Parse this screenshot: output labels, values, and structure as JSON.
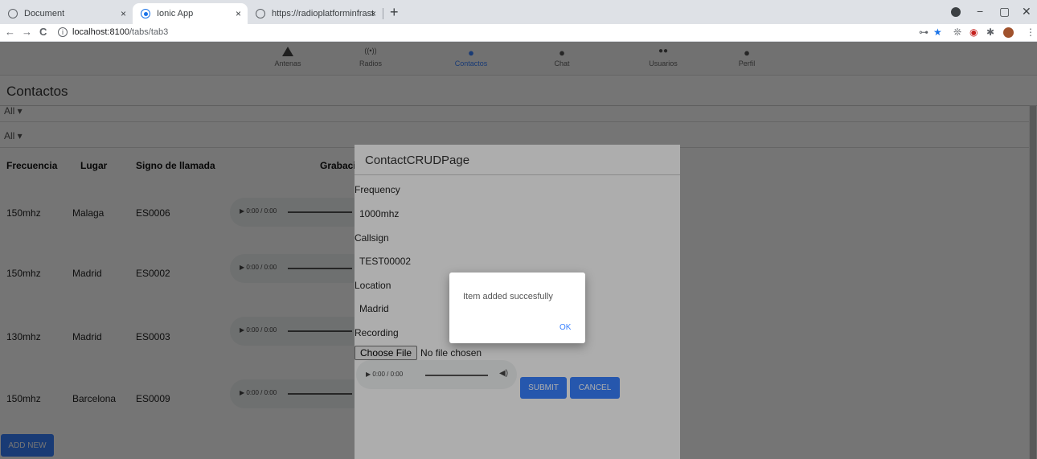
{
  "browser": {
    "tabs": [
      {
        "label": "Document",
        "active": false
      },
      {
        "label": "Ionic App",
        "active": true
      },
      {
        "label": "https://radioplatforminfrastructu",
        "active": false
      }
    ],
    "close_glyph": "×",
    "new_tab_glyph": "+",
    "window_controls": {
      "minimize": "−",
      "maximize": "▢",
      "close": "✕"
    },
    "nav": {
      "back": "←",
      "forward": "→",
      "reload": "C"
    },
    "info_glyph": "i",
    "url_host": "localhost:8100",
    "url_path": "/tabs/tab3",
    "extensions": {
      "key": "⊶",
      "star": "★",
      "bug": "❊",
      "shield": "◉",
      "puzzle": "✱",
      "menu": "⋮"
    }
  },
  "app": {
    "nav_tabs": [
      {
        "label": "Antenas",
        "icon": "antenna-icon",
        "glyph": "",
        "active": false
      },
      {
        "label": "Radios",
        "icon": "radio-signal-icon",
        "glyph": "((•))",
        "active": false
      },
      {
        "label": "Contactos",
        "icon": "person-icon",
        "glyph": "●",
        "active": true
      },
      {
        "label": "Chat",
        "icon": "chat-icon",
        "glyph": "●",
        "active": false
      },
      {
        "label": "Usuarios",
        "icon": "people-icon",
        "glyph": "●●",
        "active": false
      },
      {
        "label": "Perfil",
        "icon": "profile-icon",
        "glyph": "●",
        "active": false
      }
    ],
    "page_title": "Contactos",
    "filters": [
      "All ▾",
      "All ▾"
    ],
    "table": {
      "headers": [
        "Frecuencia",
        "Lugar",
        "Signo de llamada",
        "Grabació"
      ],
      "rows": [
        {
          "frecuencia": "150mhz",
          "lugar": "Malaga",
          "signo": "ES0006",
          "audio": "▶ 0:00 / 0:00"
        },
        {
          "frecuencia": "150mhz",
          "lugar": "Madrid",
          "signo": "ES0002",
          "audio": "▶ 0:00 / 0:00"
        },
        {
          "frecuencia": "130mhz",
          "lugar": "Madrid",
          "signo": "ES0003",
          "audio": "▶ 0:00 / 0:00"
        },
        {
          "frecuencia": "150mhz",
          "lugar": "Barcelona",
          "signo": "ES0009",
          "audio": "▶ 0:00 / 0:00"
        }
      ]
    },
    "add_new_label": "ADD NEW"
  },
  "modal": {
    "title": "ContactCRUDPage",
    "frequency_label": "Frequency",
    "frequency_value": "1000mhz",
    "callsign_label": "Callsign",
    "callsign_value": "TEST00002",
    "location_label": "Location",
    "location_value": "Madrid",
    "recording_label": "Recording",
    "choose_file_label": "Choose File",
    "file_status": "No file chosen",
    "audio_time": "▶ 0:00 / 0:00",
    "volume_glyph": "◀)",
    "submit_label": "SUBMIT",
    "cancel_label": "CANCEL"
  },
  "alert": {
    "message": "Item added succesfully",
    "ok_label": "OK"
  }
}
